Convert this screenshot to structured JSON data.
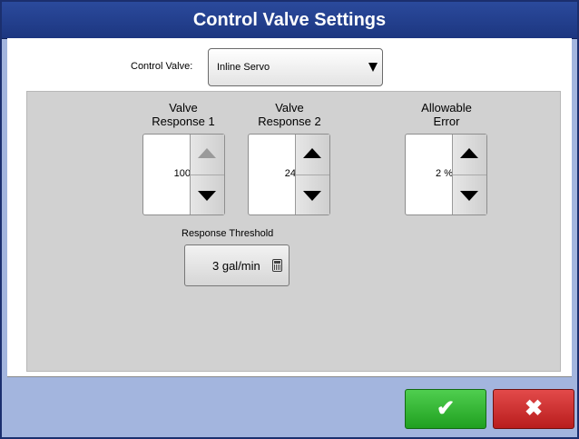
{
  "window": {
    "title": "Control Valve Settings"
  },
  "control_valve": {
    "label": "Control Valve:",
    "value": "Inline Servo",
    "icon": "dropdown-arrow-icon"
  },
  "spinners": [
    {
      "label_line1": "Valve",
      "label_line2": "Response 1",
      "value": "100",
      "up_enabled": false
    },
    {
      "label_line1": "Valve",
      "label_line2": "Response 2",
      "value": "24",
      "up_enabled": true
    },
    {
      "label_line1": "Allowable",
      "label_line2": "Error",
      "value": "2 %",
      "up_enabled": true
    }
  ],
  "response_threshold": {
    "label": "Response Threshold",
    "value": "3 gal/min",
    "icon": "calculator-icon"
  },
  "buttons": {
    "ok": {
      "glyph": "✔",
      "color": "#2db52d"
    },
    "cancel": {
      "glyph": "✖",
      "color": "#cf2f2f"
    }
  },
  "colors": {
    "title_bar": "#23418e",
    "frame_bg": "#a3b5de",
    "panel_bg": "#d1d1d1"
  }
}
